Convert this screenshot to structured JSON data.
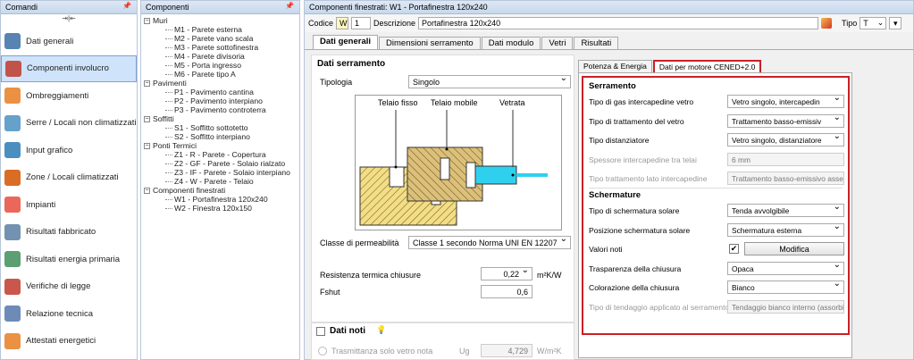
{
  "nav": {
    "title": "Comandi",
    "items": [
      {
        "label": "Dati generali",
        "icon": "document-icon"
      },
      {
        "label": "Componenti involucro",
        "icon": "envelope-components-icon"
      },
      {
        "label": "Ombreggiamenti",
        "icon": "shading-icon"
      },
      {
        "label": "Serre / Locali non climatizzati",
        "icon": "greenhouse-icon"
      },
      {
        "label": "Input grafico",
        "icon": "graphic-input-icon"
      },
      {
        "label": "Zone / Locali climatizzati",
        "icon": "house-icon"
      },
      {
        "label": "Impianti",
        "icon": "flame-icon"
      },
      {
        "label": "Risultati fabbricato",
        "icon": "calculator-icon"
      },
      {
        "label": "Risultati energia primaria",
        "icon": "calculator-green-icon"
      },
      {
        "label": "Verifiche di legge",
        "icon": "seal-icon"
      },
      {
        "label": "Relazione tecnica",
        "icon": "report-icon"
      },
      {
        "label": "Attestati energetici",
        "icon": "energy-label-icon"
      }
    ]
  },
  "tree": {
    "title": "Componenti",
    "groups": [
      {
        "label": "Muri",
        "items": [
          "M1 - Parete esterna",
          "M2 - Parete vano scala",
          "M3 - Parete sottofinestra",
          "M4 - Parete divisoria",
          "M5 - Porta ingresso",
          "M6 - Parete tipo A"
        ]
      },
      {
        "label": "Pavimenti",
        "items": [
          "P1 - Pavimento cantina",
          "P2 - Pavimento interpiano",
          "P3 - Pavimento controterra"
        ]
      },
      {
        "label": "Soffitti",
        "items": [
          "S1 - Soffitto sottotetto",
          "S2 - Soffitto interpiano"
        ]
      },
      {
        "label": "Ponti Termici",
        "items": [
          "Z1 - R - Parete - Copertura",
          "Z2 - GF - Parete - Solaio rialzato",
          "Z3 - IF - Parete - Solaio interpiano",
          "Z4 - W - Parete - Telaio"
        ]
      },
      {
        "label": "Componenti finestrati",
        "items": [
          "W1 - Portafinestra 120x240",
          "W2 - Finestra 120x150"
        ]
      }
    ]
  },
  "main": {
    "title": "Componenti finestrati: W1 - Portafinestra 120x240",
    "codice_label": "Codice",
    "codice_prefix": "W",
    "codice_value": "1",
    "descrizione_label": "Descrizione",
    "descrizione_value": "Portafinestra 120x240",
    "tipo_label": "Tipo",
    "tipo_value": "T",
    "tabs": [
      "Dati generali",
      "Dimensioni serramento",
      "Dati modulo",
      "Vetri",
      "Risultati"
    ],
    "section": "Dati serramento",
    "tipologia_label": "Tipologia",
    "tipologia_value": "Singolo",
    "diagram": {
      "telaio_fisso": "Telaio fisso",
      "telaio_mobile": "Telaio mobile",
      "vetrata": "Vetrata"
    },
    "permeabilita_label": "Classe di permeabilità",
    "permeabilita_value": "Classe 1 secondo Norma UNI EN 12207",
    "resistenza_label": "Resistenza termica chiusure",
    "resistenza_value": "0,22",
    "resistenza_unit": "m²K/W",
    "fshut_label": "Fshut",
    "fshut_value": "0,6",
    "dati_noti_label": "Dati noti",
    "trasmittanza_label": "Trasmittanza solo vetro nota",
    "ug_label": "Ug",
    "ug_value": "4,729",
    "ug_unit": "W/m²K"
  },
  "right": {
    "tabs": [
      "Potenza & Energia",
      "Dati per motore CENED+2.0"
    ],
    "serramento_title": "Serramento",
    "rows1": [
      {
        "label": "Tipo di gas intercapedine vetro",
        "value": "Vetro singolo, intercapedin"
      },
      {
        "label": "Tipo di trattamento del vetro",
        "value": "Trattamento basso-emissiv"
      },
      {
        "label": "Tipo distanziatore",
        "value": "Vetro singolo, distanziatore"
      },
      {
        "label": "Spessore intercapedine tra telai",
        "value": "6 mm"
      },
      {
        "label": "Tipo trattamento lato intercapedine",
        "value": "Trattamento basso-emissivo assent"
      }
    ],
    "schermature_title": "Schermature",
    "rows2": [
      {
        "label": "Tipo di schermatura solare",
        "value": "Tenda avvolgibile"
      },
      {
        "label": "Posizione schermatura solare",
        "value": "Schermatura esterna"
      },
      {
        "label": "Valori noti",
        "value": "Modifica"
      },
      {
        "label": "Trasparenza della chiusura",
        "value": "Opaca"
      },
      {
        "label": "Colorazione della chiusura",
        "value": "Bianco"
      },
      {
        "label": "Tipo di tendaggio applicato al serramento",
        "value": "Tendaggio bianco interno (assorbir"
      }
    ]
  },
  "colors": {
    "accent": "#cc1f26",
    "hatch": "#e8d27a"
  }
}
